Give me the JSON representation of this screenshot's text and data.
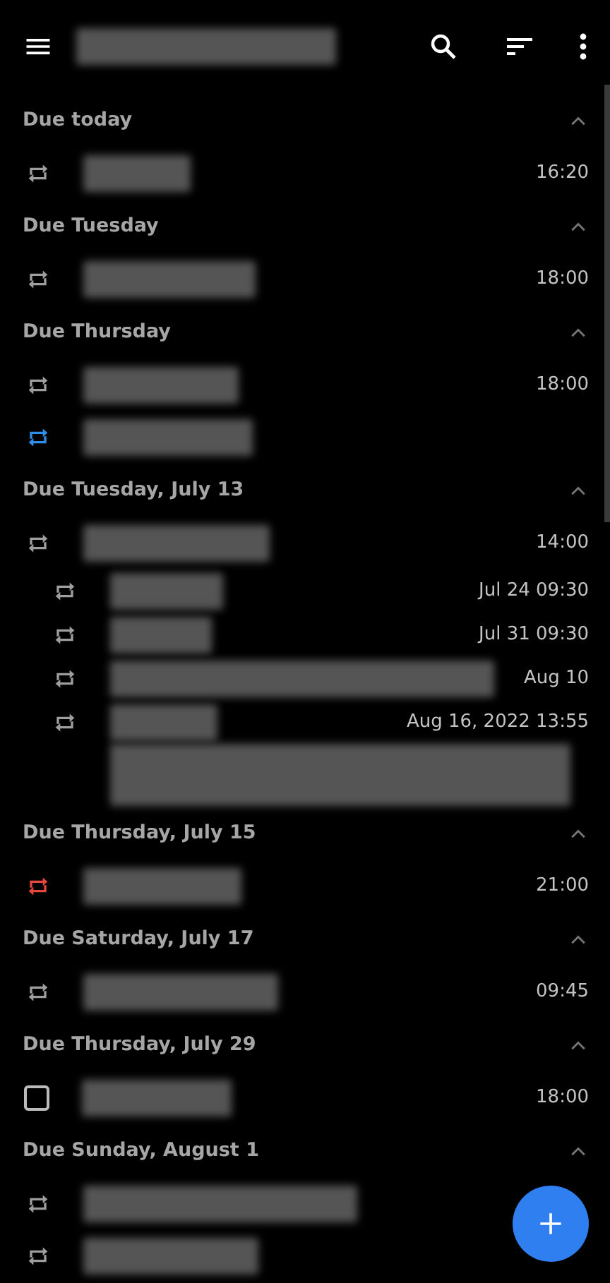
{
  "sections": [
    {
      "title": "Due today",
      "expanded": true,
      "tasks": [
        {
          "kind": "repeat",
          "color": "#9e9e9e",
          "time": "16:20"
        }
      ]
    },
    {
      "title": "Due Tuesday",
      "expanded": true,
      "tasks": [
        {
          "kind": "repeat",
          "color": "#9e9e9e",
          "time": "18:00"
        }
      ]
    },
    {
      "title": "Due Thursday",
      "expanded": true,
      "tasks": [
        {
          "kind": "repeat",
          "color": "#9e9e9e",
          "time": "18:00"
        },
        {
          "kind": "repeat",
          "color": "#2f8ee8"
        }
      ]
    },
    {
      "title": "Due Tuesday, July 13",
      "expanded": true,
      "tasks": [
        {
          "kind": "repeat",
          "color": "#9e9e9e",
          "time": "14:00",
          "children": [
            {
              "kind": "repeat",
              "color": "#9e9e9e",
              "time": "Jul 24 09:30"
            },
            {
              "kind": "repeat",
              "color": "#9e9e9e",
              "time": "Jul 31 09:30"
            },
            {
              "kind": "repeat",
              "color": "#9e9e9e",
              "time": "Aug 10"
            },
            {
              "kind": "repeat",
              "color": "#9e9e9e",
              "time": "Aug 16, 2022 13:55",
              "note": true
            }
          ]
        }
      ]
    },
    {
      "title": "Due Thursday, July 15",
      "expanded": true,
      "tasks": [
        {
          "kind": "repeat",
          "color": "#e5473f",
          "time": "21:00"
        }
      ]
    },
    {
      "title": "Due Saturday, July 17",
      "expanded": true,
      "tasks": [
        {
          "kind": "repeat",
          "color": "#9e9e9e",
          "time": "09:45"
        }
      ]
    },
    {
      "title": "Due Thursday, July 29",
      "expanded": true,
      "tasks": [
        {
          "kind": "checkbox",
          "checked": false,
          "time": "18:00"
        }
      ]
    },
    {
      "title": "Due Sunday, August 1",
      "expanded": true,
      "tasks": [
        {
          "kind": "repeat",
          "color": "#9e9e9e"
        },
        {
          "kind": "repeat",
          "color": "#9e9e9e"
        }
      ]
    }
  ]
}
